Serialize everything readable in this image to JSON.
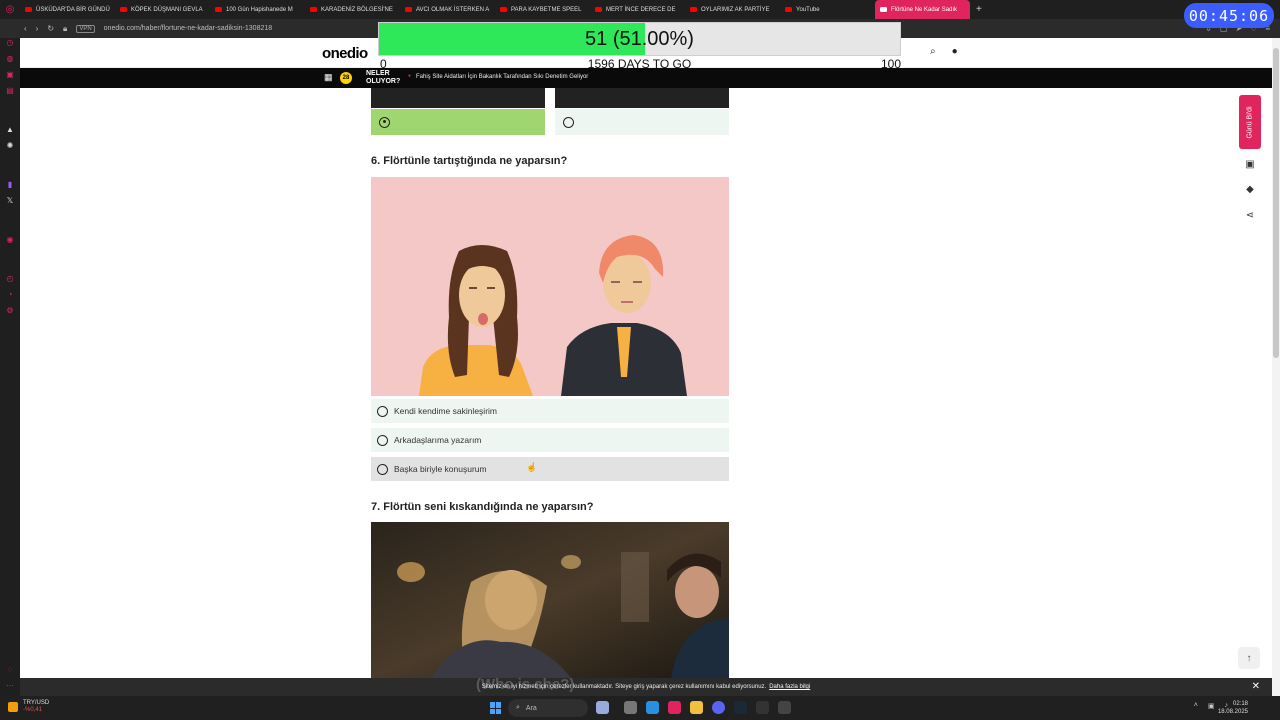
{
  "browser": {
    "tabs": [
      {
        "label": "ÜSKÜDAR'DA BİR GÜNDÜ"
      },
      {
        "label": "KÖPEK DÜŞMANI GEVLA"
      },
      {
        "label": "100 Gün Hapishanede M"
      },
      {
        "label": "KARADENİZ BÖLGESİ'NE"
      },
      {
        "label": "AVCI OLMAK İSTERKEN A"
      },
      {
        "label": "PARA KAYBETME SPEEL"
      },
      {
        "label": "MERT İNCE DERECE DE"
      },
      {
        "label": "OYLARIMIZ AK PARTİYE"
      },
      {
        "label": "YouTube"
      },
      {
        "label": "Flörtüne Ne Kadar Sadık"
      }
    ],
    "vpn_label": "VPN",
    "url": "onedio.com/haber/flortune-ne-kadar-sadiksin-1308218"
  },
  "overlay": {
    "progress_text": "51 (51.00%)",
    "progress_fraction": 0.51,
    "goal_start": "0",
    "goal_middle": "1596 DAYS TO GO",
    "goal_end": "100",
    "timer": "00:45:06"
  },
  "site": {
    "logo": "onedio",
    "news_title": "NELER OLUYOR?",
    "news_badge": "28",
    "news_text": "Fahiş Site Aidatları İçin Bakanlık Tarafından Sıkı Denetim Geliyor"
  },
  "quiz": {
    "q6_title": "6. Flörtünle tartıştığında ne yaparsın?",
    "q6_options": [
      {
        "label": "Kendi kendime sakinleşirim"
      },
      {
        "label": "Arkadaşlarıma yazarım"
      },
      {
        "label": "Başka biriyle konuşurum"
      }
    ],
    "q7_title": "7. Flörtün seni kıskandığında ne yaparsın?"
  },
  "rail": {
    "live_label": "Günü Bi'di"
  },
  "cookie": {
    "text": "Sitemiz en iyi hizmeti için çerezler kullanmaktadır. Siteye giriş yaparak çerez kullanımını kabul ediyorsunuz.",
    "more": "Daha fazla bilgi",
    "video_subtitle": "(Who is she?)"
  },
  "taskbar": {
    "ticker": "TRY/USD",
    "ticker_change": "-%0,41",
    "search": "Ara",
    "time": "02:18",
    "date": "18.08.2025"
  },
  "colors": {
    "accent": "#e0245e",
    "selected_answer": "#9fd66f",
    "option_bg": "#eef6f2",
    "progress": "#2ee85a"
  }
}
